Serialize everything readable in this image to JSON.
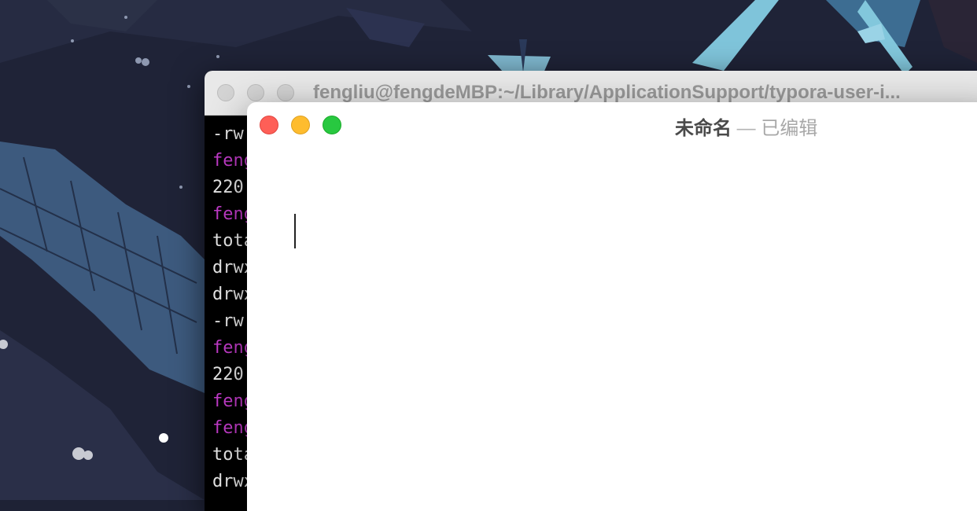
{
  "terminal": {
    "title": "fengliu@fengdeMBP:~/Library/ApplicationSupport/typora-user-i...",
    "lines": [
      {
        "text": "-rw",
        "kind": "output"
      },
      {
        "text": "feng",
        "kind": "prompt"
      },
      {
        "text": "220",
        "kind": "output"
      },
      {
        "text": "feng",
        "kind": "prompt"
      },
      {
        "text": "tota",
        "kind": "output"
      },
      {
        "text": "drwx",
        "kind": "output"
      },
      {
        "text": "drwx",
        "kind": "output"
      },
      {
        "text": "-rw",
        "kind": "output"
      },
      {
        "text": "feng",
        "kind": "prompt"
      },
      {
        "text": "220",
        "kind": "output"
      },
      {
        "text": "feng",
        "kind": "prompt"
      },
      {
        "text": "feng",
        "kind": "prompt"
      },
      {
        "text": "tota",
        "kind": "output"
      },
      {
        "text": "drwx",
        "kind": "output"
      }
    ]
  },
  "editor": {
    "title_name": "未命名",
    "title_separator": "—",
    "title_status": "已编辑"
  },
  "colors": {
    "close": "#fe5f57",
    "minimize": "#febc2e",
    "maximize": "#28c840",
    "prompt": "#c13bc9"
  }
}
